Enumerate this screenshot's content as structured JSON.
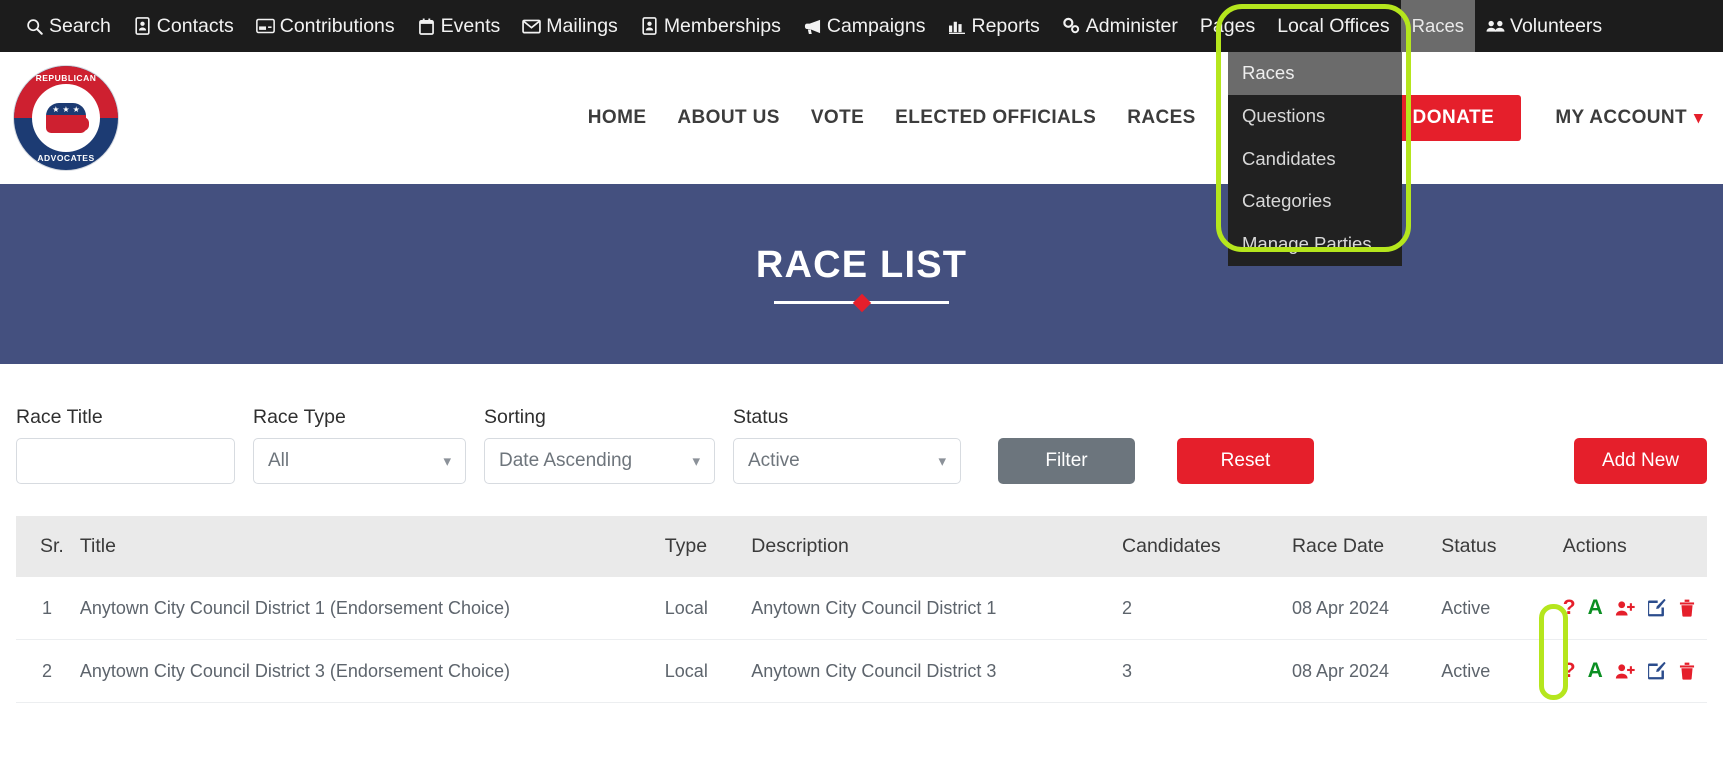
{
  "admin_bar": {
    "items": [
      {
        "label": "Search",
        "icon": "search-icon"
      },
      {
        "label": "Contacts",
        "icon": "contact-card-icon"
      },
      {
        "label": "Contributions",
        "icon": "credit-card-icon"
      },
      {
        "label": "Events",
        "icon": "calendar-icon"
      },
      {
        "label": "Mailings",
        "icon": "envelope-icon"
      },
      {
        "label": "Memberships",
        "icon": "membership-card-icon"
      },
      {
        "label": "Campaigns",
        "icon": "bullhorn-icon"
      },
      {
        "label": "Reports",
        "icon": "bar-chart-icon"
      },
      {
        "label": "Administer",
        "icon": "gears-icon"
      },
      {
        "label": "Pages",
        "icon": ""
      },
      {
        "label": "Local Offices",
        "icon": ""
      },
      {
        "label": "Races",
        "icon": ""
      },
      {
        "label": "Volunteers",
        "icon": "users-group-icon"
      }
    ]
  },
  "races_dropdown": {
    "items": [
      {
        "label": "Races",
        "highlighted": true
      },
      {
        "label": "Questions",
        "highlighted": false
      },
      {
        "label": "Candidates",
        "highlighted": false
      },
      {
        "label": "Categories",
        "highlighted": false
      },
      {
        "label": "Manage Parties",
        "highlighted": false
      }
    ]
  },
  "site_header": {
    "logo": {
      "text_top": "REPUBLICAN",
      "text_bottom": "ADVOCATES"
    },
    "nav": [
      {
        "label": "HOME"
      },
      {
        "label": "ABOUT US"
      },
      {
        "label": "VOTE"
      },
      {
        "label": "ELECTED OFFICIALS"
      },
      {
        "label": "RACES"
      }
    ],
    "donate_label": "DONATE",
    "my_account_label": "MY ACCOUNT"
  },
  "banner": {
    "title": "RACE LIST"
  },
  "filters": {
    "race_title": {
      "label": "Race Title",
      "value": "",
      "placeholder": ""
    },
    "race_type": {
      "label": "Race Type",
      "value": "All"
    },
    "sorting": {
      "label": "Sorting",
      "value": "Date Ascending"
    },
    "status": {
      "label": "Status",
      "value": "Active"
    },
    "filter_button": "Filter",
    "reset_button": "Reset",
    "add_new_button": "Add New"
  },
  "table": {
    "columns": [
      "Sr.",
      "Title",
      "Type",
      "Description",
      "Candidates",
      "Race Date",
      "Status",
      "Actions"
    ],
    "rows": [
      {
        "sr": "1",
        "title": "Anytown City Council District 1 (Endorsement Choice)",
        "type": "Local",
        "description": "Anytown City Council District 1",
        "candidates": "2",
        "race_date": "08 Apr 2024",
        "status": "Active"
      },
      {
        "sr": "2",
        "title": "Anytown City Council District 3 (Endorsement Choice)",
        "type": "Local",
        "description": "Anytown City Council District 3",
        "candidates": "3",
        "race_date": "08 Apr 2024",
        "status": "Active"
      }
    ],
    "row_actions": [
      {
        "icon": "question-mark-icon",
        "glyph": "?"
      },
      {
        "icon": "letter-a-icon",
        "glyph": "A"
      },
      {
        "icon": "add-candidate-icon",
        "glyph": ""
      },
      {
        "icon": "edit-icon",
        "glyph": ""
      },
      {
        "icon": "delete-trash-icon",
        "glyph": ""
      }
    ]
  },
  "colors": {
    "admin_bar_bg": "#1c1c1c",
    "dropdown_bg": "#212121",
    "dropdown_highlight": "#6b6b6b",
    "banner_bg": "#44507f",
    "accent_red": "#e51f2b",
    "filter_gray": "#6c757d",
    "annotation_green": "#b5e61d",
    "action_green": "#0a8f22",
    "action_blue": "#2b4c8c"
  }
}
